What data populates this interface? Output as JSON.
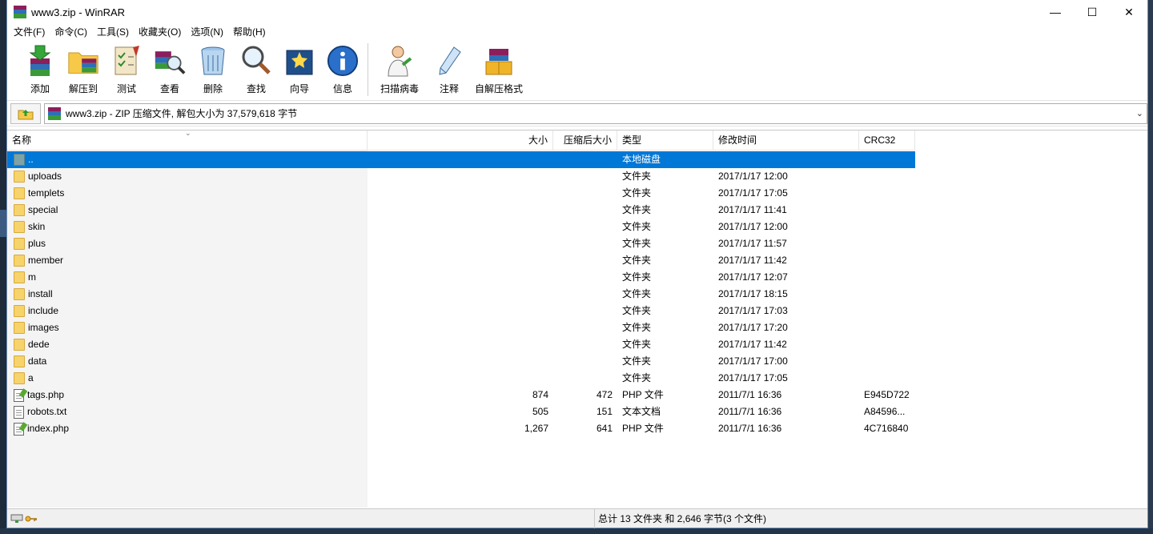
{
  "window": {
    "title": "www3.zip - WinRAR",
    "minimize_glyph": "—",
    "maximize_glyph": "☐",
    "close_glyph": "✕"
  },
  "menu": [
    "文件(F)",
    "命令(C)",
    "工具(S)",
    "收藏夹(O)",
    "选项(N)",
    "帮助(H)"
  ],
  "toolbar": [
    {
      "label": "添加",
      "icon": "add-icon"
    },
    {
      "label": "解压到",
      "icon": "extract-to-icon"
    },
    {
      "label": "测试",
      "icon": "test-icon"
    },
    {
      "label": "查看",
      "icon": "view-icon"
    },
    {
      "label": "删除",
      "icon": "delete-icon"
    },
    {
      "label": "查找",
      "icon": "find-icon"
    },
    {
      "label": "向导",
      "icon": "wizard-icon"
    },
    {
      "label": "信息",
      "icon": "info-icon"
    },
    {
      "label": "扫描病毒",
      "icon": "virus-scan-icon"
    },
    {
      "label": "注释",
      "icon": "comment-icon"
    },
    {
      "label": "自解压格式",
      "icon": "sfx-icon"
    }
  ],
  "address": {
    "path": "www3.zip - ZIP 压缩文件, 解包大小为 37,579,618 字节"
  },
  "columns": {
    "name": "名称",
    "size": "大小",
    "packed": "压缩后大小",
    "type": "类型",
    "modified": "修改时间",
    "crc": "CRC32"
  },
  "files": [
    {
      "name": "..",
      "size": "",
      "packed": "",
      "type": "本地磁盘",
      "modified": "",
      "crc": "",
      "kind": "updir",
      "selected": true
    },
    {
      "name": "uploads",
      "size": "",
      "packed": "",
      "type": "文件夹",
      "modified": "2017/1/17 12:00",
      "crc": "",
      "kind": "folder"
    },
    {
      "name": "templets",
      "size": "",
      "packed": "",
      "type": "文件夹",
      "modified": "2017/1/17 17:05",
      "crc": "",
      "kind": "folder"
    },
    {
      "name": "special",
      "size": "",
      "packed": "",
      "type": "文件夹",
      "modified": "2017/1/17 11:41",
      "crc": "",
      "kind": "folder"
    },
    {
      "name": "skin",
      "size": "",
      "packed": "",
      "type": "文件夹",
      "modified": "2017/1/17 12:00",
      "crc": "",
      "kind": "folder"
    },
    {
      "name": "plus",
      "size": "",
      "packed": "",
      "type": "文件夹",
      "modified": "2017/1/17 11:57",
      "crc": "",
      "kind": "folder"
    },
    {
      "name": "member",
      "size": "",
      "packed": "",
      "type": "文件夹",
      "modified": "2017/1/17 11:42",
      "crc": "",
      "kind": "folder"
    },
    {
      "name": "m",
      "size": "",
      "packed": "",
      "type": "文件夹",
      "modified": "2017/1/17 12:07",
      "crc": "",
      "kind": "folder"
    },
    {
      "name": "install",
      "size": "",
      "packed": "",
      "type": "文件夹",
      "modified": "2017/1/17 18:15",
      "crc": "",
      "kind": "folder"
    },
    {
      "name": "include",
      "size": "",
      "packed": "",
      "type": "文件夹",
      "modified": "2017/1/17 17:03",
      "crc": "",
      "kind": "folder"
    },
    {
      "name": "images",
      "size": "",
      "packed": "",
      "type": "文件夹",
      "modified": "2017/1/17 17:20",
      "crc": "",
      "kind": "folder"
    },
    {
      "name": "dede",
      "size": "",
      "packed": "",
      "type": "文件夹",
      "modified": "2017/1/17 11:42",
      "crc": "",
      "kind": "folder"
    },
    {
      "name": "data",
      "size": "",
      "packed": "",
      "type": "文件夹",
      "modified": "2017/1/17 17:00",
      "crc": "",
      "kind": "folder"
    },
    {
      "name": "a",
      "size": "",
      "packed": "",
      "type": "文件夹",
      "modified": "2017/1/17 17:05",
      "crc": "",
      "kind": "folder"
    },
    {
      "name": "tags.php",
      "size": "874",
      "packed": "472",
      "type": "PHP 文件",
      "modified": "2011/7/1 16:36",
      "crc": "E945D722",
      "kind": "php"
    },
    {
      "name": "robots.txt",
      "size": "505",
      "packed": "151",
      "type": "文本文档",
      "modified": "2011/7/1 16:36",
      "crc": "A84596...",
      "kind": "txt"
    },
    {
      "name": "index.php",
      "size": "1,267",
      "packed": "641",
      "type": "PHP 文件",
      "modified": "2011/7/1 16:36",
      "crc": "4C716840",
      "kind": "php"
    }
  ],
  "status": {
    "summary": "总计 13 文件夹 和 2,646 字节(3 个文件)"
  },
  "colors": {
    "selection": "#0078d7",
    "folder": "#f7d36b"
  }
}
